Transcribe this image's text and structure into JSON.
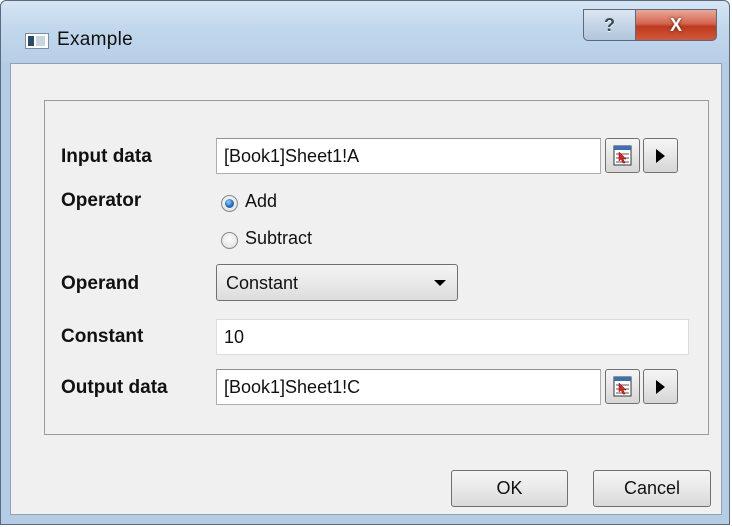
{
  "window": {
    "title": "Example",
    "help_label": "?",
    "close_label": "X"
  },
  "form": {
    "input_data": {
      "label": "Input data",
      "value": "[Book1]Sheet1!A"
    },
    "operator": {
      "label": "Operator",
      "options": [
        {
          "label": "Add",
          "selected": true
        },
        {
          "label": "Subtract",
          "selected": false
        }
      ]
    },
    "operand": {
      "label": "Operand",
      "value": "Constant"
    },
    "constant": {
      "label": "Constant",
      "value": "10"
    },
    "output_data": {
      "label": "Output data",
      "value": "[Book1]Sheet1!C"
    }
  },
  "buttons": {
    "ok": "OK",
    "cancel": "Cancel"
  },
  "icons": {
    "range_select": "range-select-icon",
    "expand_arrow": "play-arrow-icon"
  },
  "colors": {
    "close_button": "#c0391e",
    "radio_selected": "#1e6fc7",
    "titlebar": "#c2d7ec"
  }
}
